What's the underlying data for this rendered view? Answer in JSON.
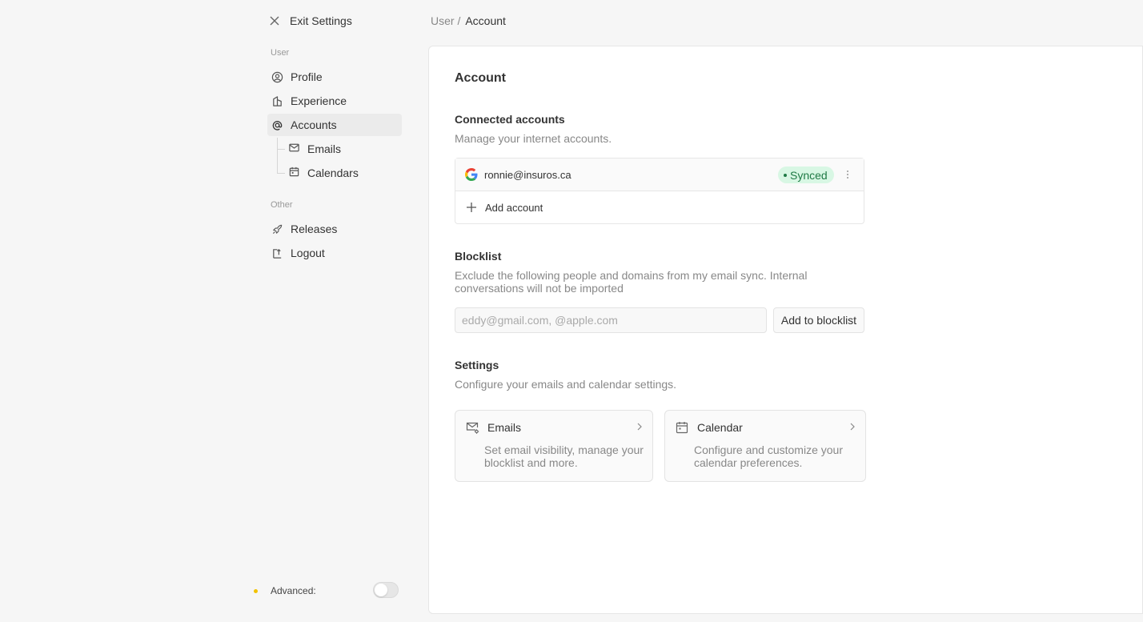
{
  "sidebar": {
    "exit_label": "Exit Settings",
    "user_section": "User",
    "other_section": "Other",
    "items": {
      "profile": "Profile",
      "experience": "Experience",
      "accounts": "Accounts",
      "emails": "Emails",
      "calendars": "Calendars",
      "releases": "Releases",
      "logout": "Logout"
    },
    "advanced_label": "Advanced:",
    "advanced_enabled": false
  },
  "breadcrumb": {
    "parent": "User /",
    "current": "Account"
  },
  "main": {
    "title": "Account",
    "connected": {
      "heading": "Connected accounts",
      "description": "Manage your internet accounts.",
      "account_email": "ronnie@insuros.ca",
      "status": "Synced",
      "add_label": "Add account"
    },
    "blocklist": {
      "heading": "Blocklist",
      "description_line1": "Exclude the following people and domains from my email sync. Internal",
      "description_line2": "conversations will not be imported",
      "placeholder": "eddy@gmail.com, @apple.com",
      "button": "Add to blocklist"
    },
    "settings": {
      "heading": "Settings",
      "description": "Configure your emails and calendar settings.",
      "cards": {
        "emails": {
          "title": "Emails",
          "desc_line1": "Set email visibility, manage your",
          "desc_line2": "blocklist and more."
        },
        "calendar": {
          "title": "Calendar",
          "desc_line1": "Configure and customize your",
          "desc_line2": "calendar preferences."
        }
      }
    }
  },
  "colors": {
    "synced_bg": "#d8f7e4",
    "synced_text": "#1f7a45",
    "advanced_dot": "#f2c200"
  },
  "icons": [
    "close-icon",
    "user-circle-icon",
    "experience-icon",
    "at-icon",
    "mail-icon",
    "calendar-icon",
    "rocket-icon",
    "logout-icon",
    "google-icon",
    "more-vertical-icon",
    "plus-icon",
    "mail-settings-icon",
    "chevron-right-icon"
  ]
}
